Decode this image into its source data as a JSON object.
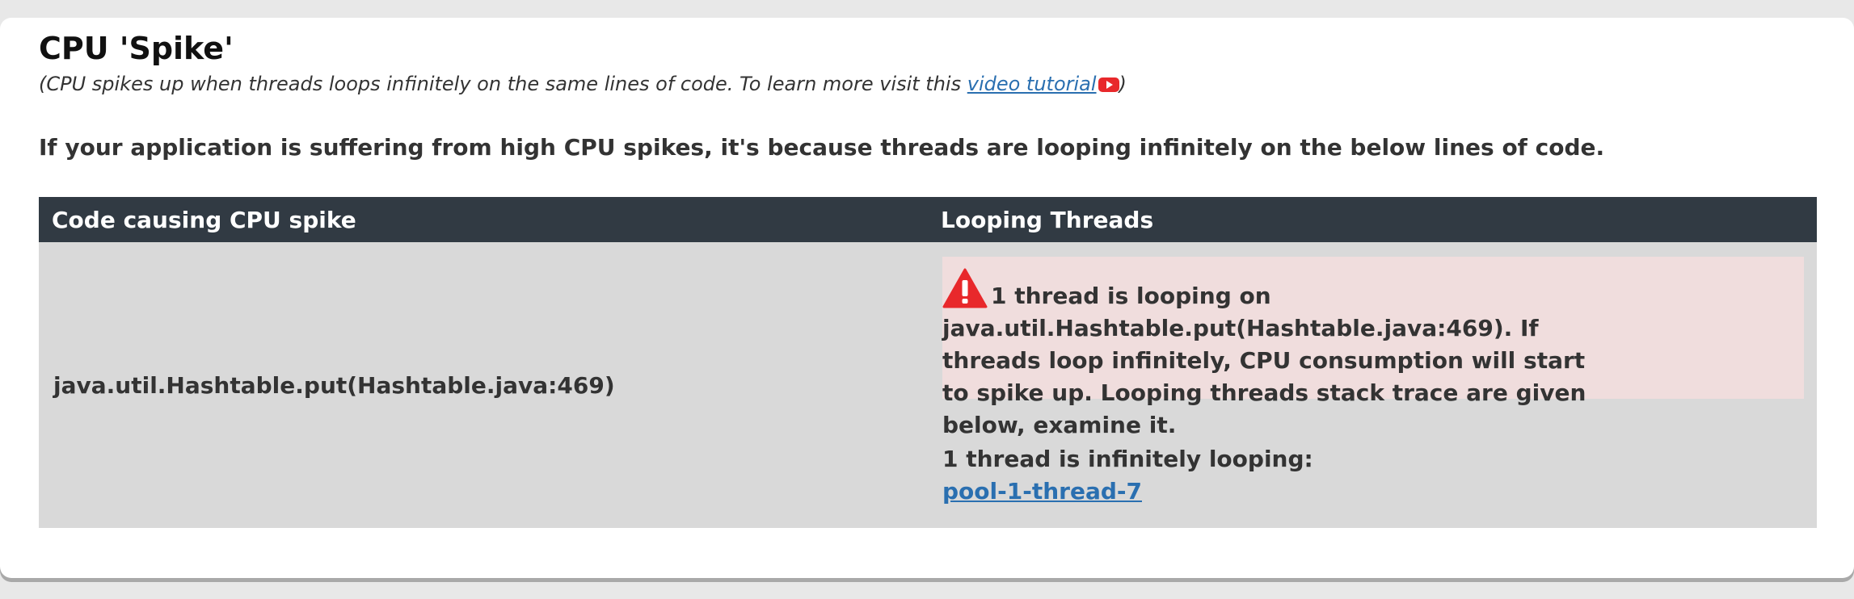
{
  "section": {
    "title": "CPU 'Spike'",
    "subtitle_prefix": "(CPU spikes up when threads loops infinitely on the same lines of code. To learn more visit this ",
    "subtitle_link": "video tutorial",
    "subtitle_suffix": ")",
    "intro": "If your application is suffering from high CPU spikes, it's because threads are looping infinitely on the below lines of code."
  },
  "table": {
    "headers": [
      "Code causing CPU spike",
      "Looping Threads"
    ],
    "rows": [
      {
        "code": "java.util.Hashtable.put(Hashtable.java:469)",
        "alert": "1 thread is looping on java.util.Hashtable.put(Hashtable.java:469). If threads loop infinitely, CPU consumption will start to spike up. Looping threads stack trace are given below, examine it.",
        "count_label": "1 thread is infinitely looping:",
        "threads": [
          "pool-1-thread-7"
        ]
      }
    ]
  },
  "icons": {
    "youtube": "youtube-play-icon",
    "warning": "warning-triangle-icon"
  },
  "colors": {
    "header_bg": "#313a43",
    "row_bg": "#d9d9d9",
    "alert_bg": "#f0dddd",
    "link": "#2a6fb0",
    "warning_red": "#e8282b"
  }
}
